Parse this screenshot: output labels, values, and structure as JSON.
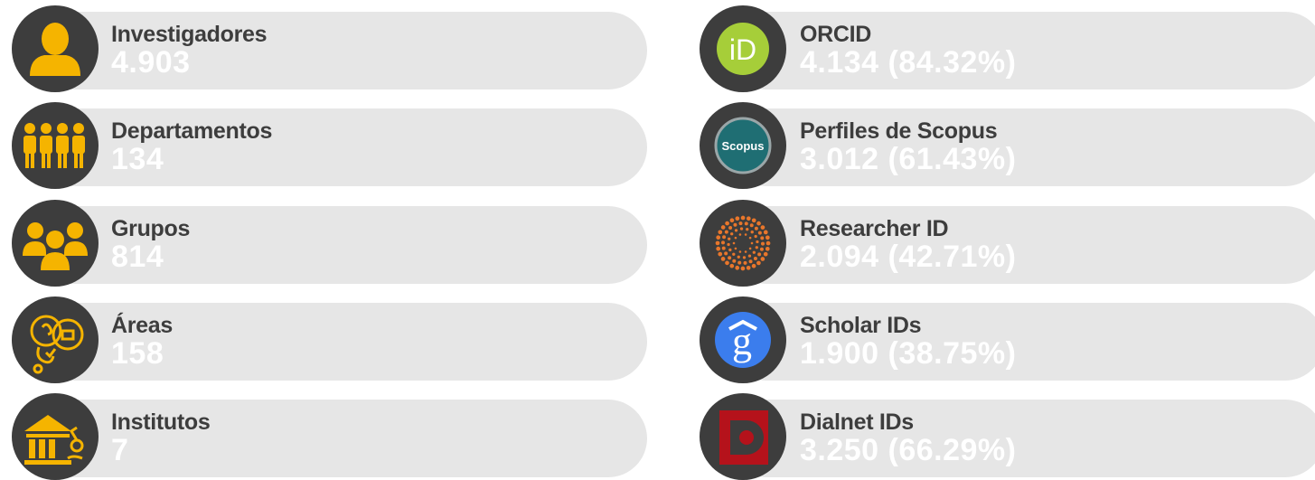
{
  "colors": {
    "pill": "#e6e6e6",
    "icon_bg": "#3d3d3d",
    "title_text": "#3d3d3d",
    "value_text": "#ffffff",
    "gold_icon": "#f5b400",
    "orcid_green": "#a6ce39",
    "scopus_teal": "#1f6e73",
    "researcherid_orange": "#e8762b",
    "scholar_blue": "#3b7ded",
    "dialnet_red": "#b5121b"
  },
  "left_stats": [
    {
      "icon": "person-icon",
      "title": "Investigadores",
      "value": "4.903"
    },
    {
      "icon": "people-row-icon",
      "title": "Departamentos",
      "value": "134"
    },
    {
      "icon": "group-icon",
      "title": "Grupos",
      "value": "814"
    },
    {
      "icon": "science-areas-icon",
      "title": "Áreas",
      "value": "158"
    },
    {
      "icon": "institute-building-icon",
      "title": "Institutos",
      "value": "7"
    }
  ],
  "right_stats": [
    {
      "icon": "orcid-icon",
      "icon_text": "iD",
      "title": "ORCID",
      "value": "4.134 (84.32%)"
    },
    {
      "icon": "scopus-icon",
      "icon_text": "Scopus",
      "title": "Perfiles de Scopus",
      "value": "3.012 (61.43%)"
    },
    {
      "icon": "researcher-id-icon",
      "title": "Researcher ID",
      "value": "2.094 (42.71%)"
    },
    {
      "icon": "google-scholar-icon",
      "icon_text": "g",
      "title": "Scholar IDs",
      "value": "1.900 (38.75%)"
    },
    {
      "icon": "dialnet-icon",
      "title": "Dialnet IDs",
      "value": "3.250 (66.29%)"
    }
  ]
}
